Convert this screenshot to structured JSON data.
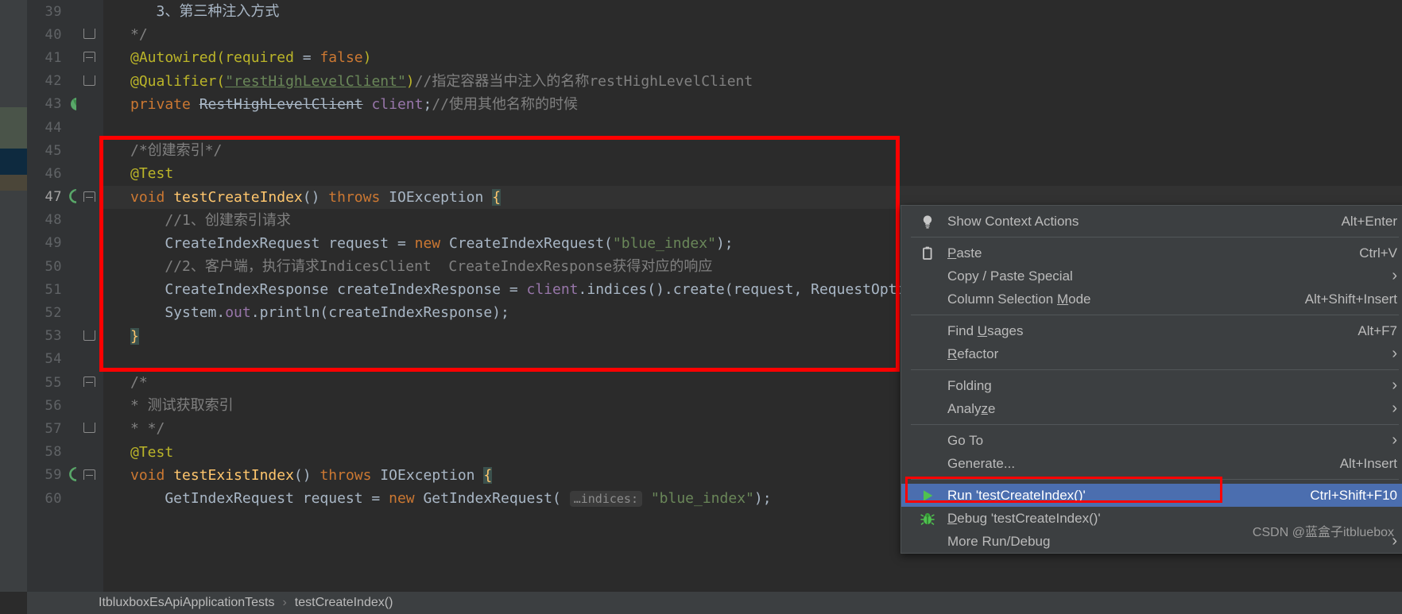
{
  "app": {
    "theme_bg": "#2b2b2b",
    "gutter_bg": "#313335",
    "panel_bg": "#3c3f41",
    "accent_selection": "#4b6eaf",
    "annotation_red": "#ff0000"
  },
  "editor": {
    "lines": [
      {
        "num": "39",
        "gutter_icon": "none",
        "fold": "v-line",
        "text": "   3、第三种注入方式"
      },
      {
        "num": "40",
        "gutter_icon": "none",
        "fold": "fold-end",
        "text": "*/"
      },
      {
        "num": "41",
        "gutter_icon": "none",
        "fold": "fold-start",
        "text": "@Autowired(required = false)"
      },
      {
        "num": "42",
        "gutter_icon": "none",
        "fold": "fold-end",
        "text": "@Qualifier(\"restHighLevelClient\") //指定容器当中注入的名称restHighLevelClient"
      },
      {
        "num": "43",
        "gutter_icon": "bean-icon",
        "fold": "none",
        "text": "private RestHighLevelClient client;//使用其他名称的时候"
      },
      {
        "num": "44",
        "gutter_icon": "none",
        "fold": "none",
        "text": ""
      },
      {
        "num": "45",
        "gutter_icon": "none",
        "fold": "none",
        "text": "/*创建索引*/"
      },
      {
        "num": "46",
        "gutter_icon": "none",
        "fold": "none",
        "text": "@Test"
      },
      {
        "num": "47",
        "gutter_icon": "run-test-icon",
        "fold": "fold-start",
        "text": "void testCreateIndex() throws IOException {"
      },
      {
        "num": "48",
        "gutter_icon": "none",
        "fold": "none",
        "text": "    //1、创建索引请求"
      },
      {
        "num": "49",
        "gutter_icon": "none",
        "fold": "none",
        "text": "    CreateIndexRequest request = new CreateIndexRequest(\"blue_index\");"
      },
      {
        "num": "50",
        "gutter_icon": "none",
        "fold": "none",
        "text": "    //2、客户端，执行请求IndicesClient  CreateIndexResponse获得对应的响应"
      },
      {
        "num": "51",
        "gutter_icon": "none",
        "fold": "none",
        "text": "    CreateIndexResponse createIndexResponse = client.indices().create(request, RequestOptio"
      },
      {
        "num": "52",
        "gutter_icon": "none",
        "fold": "none",
        "text": "    System.out.println(createIndexResponse);"
      },
      {
        "num": "53",
        "gutter_icon": "none",
        "fold": "fold-end",
        "text": "}"
      },
      {
        "num": "54",
        "gutter_icon": "none",
        "fold": "none",
        "text": ""
      },
      {
        "num": "55",
        "gutter_icon": "none",
        "fold": "fold-start",
        "text": "/*"
      },
      {
        "num": "56",
        "gutter_icon": "none",
        "fold": "none",
        "text": "* 测试获取索引"
      },
      {
        "num": "57",
        "gutter_icon": "none",
        "fold": "fold-end",
        "text": "* */"
      },
      {
        "num": "58",
        "gutter_icon": "none",
        "fold": "none",
        "text": "@Test"
      },
      {
        "num": "59",
        "gutter_icon": "run-test-icon",
        "fold": "fold-start",
        "text": "void testExistIndex() throws IOException {"
      },
      {
        "num": "60",
        "gutter_icon": "none",
        "fold": "none",
        "text": "    GetIndexRequest request = new GetIndexRequest( …indices: \"blue_index\");"
      }
    ],
    "parameter_hint": "…indices:",
    "selected_line_number": "47"
  },
  "breadcrumb": {
    "class_name": "ItbluxboxEsApiApplicationTests",
    "separator": "›",
    "method_name": "testCreateIndex()"
  },
  "context_menu": {
    "items": [
      {
        "label": "Show Context Actions",
        "shortcut": "Alt+Enter",
        "icon": "lightbulb-icon",
        "arrow": false,
        "selected": false,
        "mnemonic": ""
      },
      {
        "type": "separator"
      },
      {
        "label": "Paste",
        "shortcut": "Ctrl+V",
        "icon": "clipboard-icon",
        "arrow": false,
        "selected": false,
        "mnemonic": "P"
      },
      {
        "label": "Copy / Paste Special",
        "shortcut": "",
        "icon": "none",
        "arrow": true,
        "selected": false,
        "mnemonic": ""
      },
      {
        "label": "Column Selection Mode",
        "shortcut": "Alt+Shift+Insert",
        "icon": "none",
        "arrow": false,
        "selected": false,
        "mnemonic": "M"
      },
      {
        "type": "separator"
      },
      {
        "label": "Find Usages",
        "shortcut": "Alt+F7",
        "icon": "none",
        "arrow": false,
        "selected": false,
        "mnemonic": "U"
      },
      {
        "label": "Refactor",
        "shortcut": "",
        "icon": "none",
        "arrow": true,
        "selected": false,
        "mnemonic": "R"
      },
      {
        "type": "separator"
      },
      {
        "label": "Folding",
        "shortcut": "",
        "icon": "none",
        "arrow": true,
        "selected": false,
        "mnemonic": ""
      },
      {
        "label": "Analyze",
        "shortcut": "",
        "icon": "none",
        "arrow": true,
        "selected": false,
        "mnemonic": "z"
      },
      {
        "type": "separator"
      },
      {
        "label": "Go To",
        "shortcut": "",
        "icon": "none",
        "arrow": true,
        "selected": false,
        "mnemonic": ""
      },
      {
        "label": "Generate...",
        "shortcut": "Alt+Insert",
        "icon": "none",
        "arrow": false,
        "selected": false,
        "mnemonic": ""
      },
      {
        "type": "separator"
      },
      {
        "label": "Run 'testCreateIndex()'",
        "shortcut": "Ctrl+Shift+F10",
        "icon": "run-green-triangle-icon",
        "arrow": false,
        "selected": true,
        "mnemonic": "u"
      },
      {
        "label": "Debug 'testCreateIndex()'",
        "shortcut": "",
        "icon": "debug-bug-icon",
        "arrow": false,
        "selected": false,
        "mnemonic": "D"
      },
      {
        "label": "More Run/Debug",
        "shortcut": "",
        "icon": "none",
        "arrow": true,
        "selected": false,
        "mnemonic": ""
      }
    ]
  },
  "watermark": {
    "text": "CSDN @蓝盒子itbluebox"
  }
}
